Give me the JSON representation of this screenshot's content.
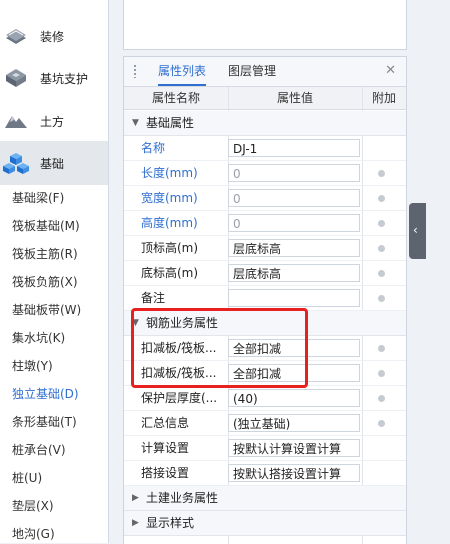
{
  "sidebar": {
    "categories": [
      {
        "label": "装修",
        "icon": "decoration-icon"
      },
      {
        "label": "基坑支护",
        "icon": "pit-support-icon"
      },
      {
        "label": "土方",
        "icon": "earthwork-icon"
      },
      {
        "label": "基础",
        "icon": "foundation-icon",
        "active": true
      }
    ],
    "sub_items": [
      "基础梁(F)",
      "筏板基础(M)",
      "筏板主筋(R)",
      "筏板负筋(X)",
      "基础板带(W)",
      "集水坑(K)",
      "柱墩(Y)",
      "独立基础(D)",
      "条形基础(T)",
      "桩承台(V)",
      "桩(U)",
      "垫层(X)",
      "地沟(G)"
    ],
    "selected_sub_item": "独立基础(D)",
    "accent_color": "#2f6fd0"
  },
  "panel": {
    "tabs": [
      {
        "label": "属性列表",
        "active": true
      },
      {
        "label": "图层管理",
        "active": false
      }
    ],
    "close_icon": "close-icon",
    "columns": [
      "属性名称",
      "属性值",
      "附加"
    ],
    "groups": [
      {
        "title": "基础属性",
        "expanded": true,
        "rows": [
          {
            "name": "名称",
            "value": "DJ-1",
            "blue": true,
            "dot": false
          },
          {
            "name": "长度(mm)",
            "value": "0",
            "blue": true,
            "gray": true,
            "dot": true
          },
          {
            "name": "宽度(mm)",
            "value": "0",
            "blue": true,
            "gray": true,
            "dot": true
          },
          {
            "name": "高度(mm)",
            "value": "0",
            "blue": true,
            "gray": true,
            "dot": true
          },
          {
            "name": "顶标高(m)",
            "value": "层底标高",
            "dot": true
          },
          {
            "name": "底标高(m)",
            "value": "层底标高",
            "dot": true
          },
          {
            "name": "备注",
            "value": "",
            "dot": true
          }
        ]
      },
      {
        "title": "钢筋业务属性",
        "expanded": true,
        "rows": [
          {
            "name": "扣减板/筏板...",
            "value": "全部扣减",
            "dot": true
          },
          {
            "name": "扣减板/筏板...",
            "value": "全部扣减",
            "dot": true
          },
          {
            "name": "保护层厚度(...",
            "value": "(40)",
            "dot": true
          },
          {
            "name": "汇总信息",
            "value": "(独立基础)",
            "dot": true
          },
          {
            "name": "计算设置",
            "value": "按默认计算设置计算",
            "dot": false
          },
          {
            "name": "搭接设置",
            "value": "按默认搭接设置计算",
            "dot": false
          }
        ]
      },
      {
        "title": "土建业务属性",
        "expanded": false,
        "rows": []
      },
      {
        "title": "显示样式",
        "expanded": false,
        "rows": []
      }
    ],
    "highlight_color": "#e8201f"
  },
  "side_handle": {
    "icon": "collapse-chevron-left-icon",
    "glyph": "‹"
  }
}
